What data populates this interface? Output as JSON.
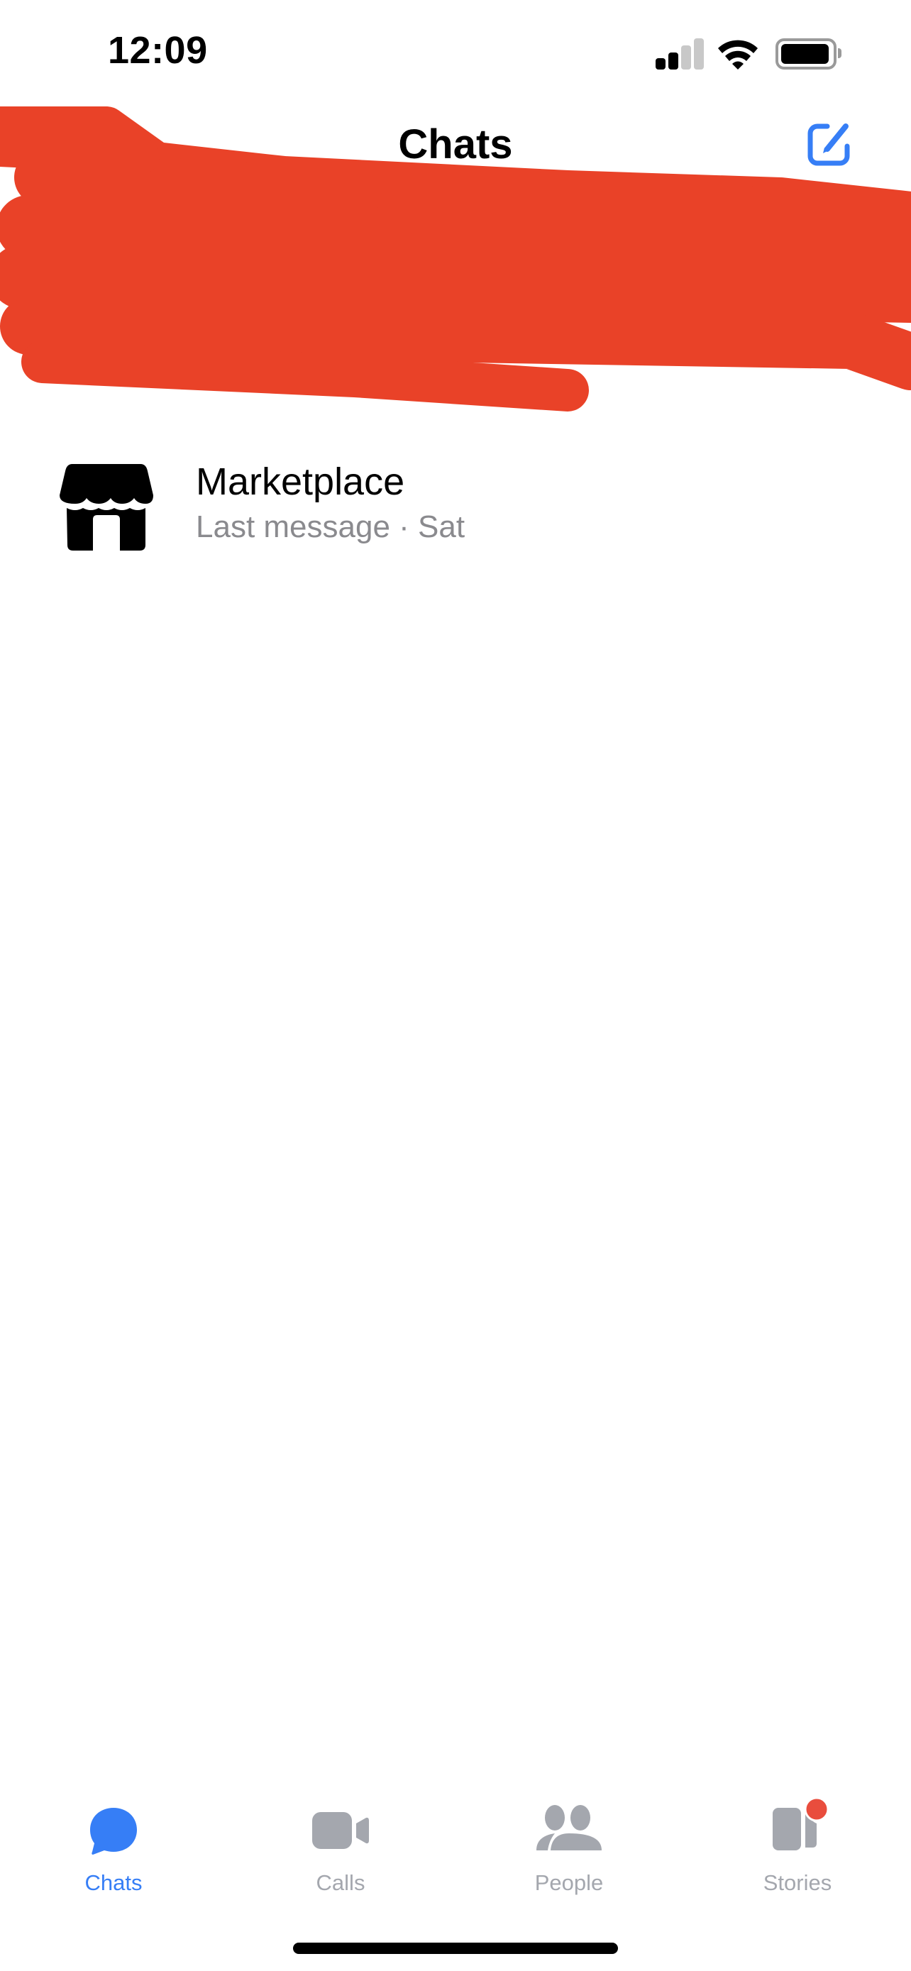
{
  "status_bar": {
    "time": "12:09",
    "signal_bars_active": 2,
    "signal_bars_total": 4,
    "wifi": "wifi-icon",
    "battery_level": 0.95
  },
  "header": {
    "title": "Chats",
    "compose_icon": "compose-icon"
  },
  "redacted_region": {
    "description": "Stories / active contacts row obscured by red scribble",
    "color": "#e94228"
  },
  "chats": [
    {
      "name": "Marketplace",
      "preview": "Last message · Sat",
      "icon": "storefront-icon"
    }
  ],
  "tab_bar": {
    "active_color": "#367ef6",
    "inactive_color": "#a4a7ae",
    "badge_color": "#e94d3d",
    "tabs": [
      {
        "label": "Chats",
        "icon": "chat-bubble-icon",
        "active": true
      },
      {
        "label": "Calls",
        "icon": "video-camera-icon",
        "active": false
      },
      {
        "label": "People",
        "icon": "people-icon",
        "active": false
      },
      {
        "label": "Stories",
        "icon": "stories-icon",
        "active": false,
        "badge": true
      }
    ]
  }
}
